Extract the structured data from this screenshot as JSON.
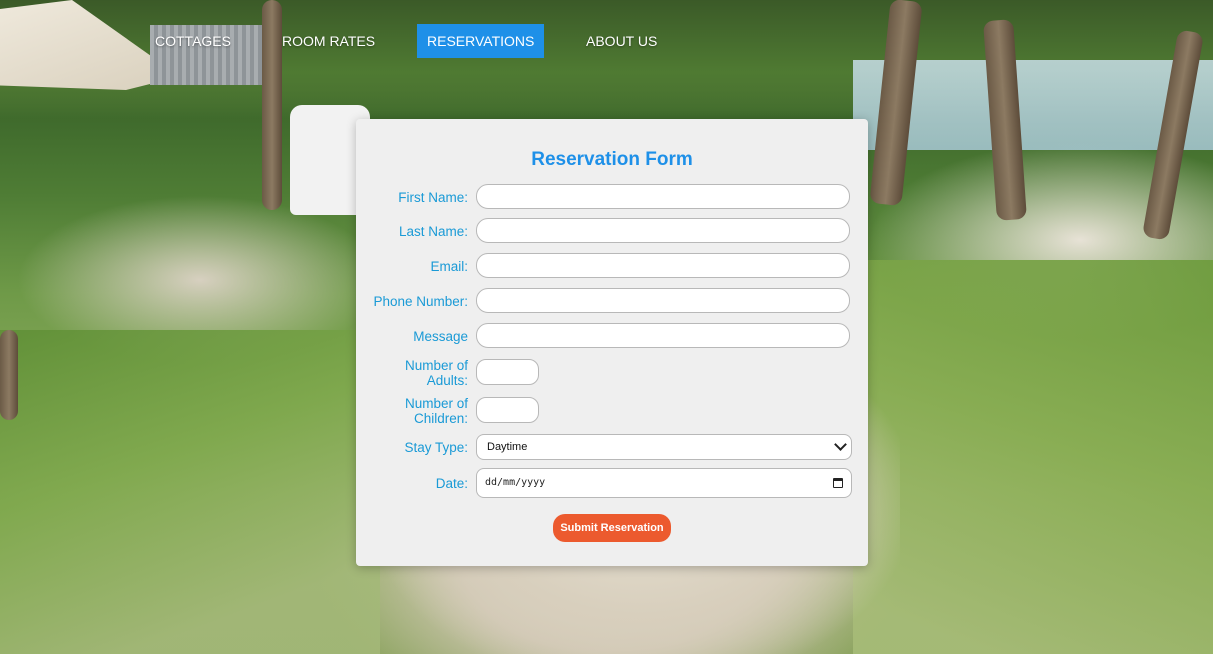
{
  "nav": {
    "items": [
      {
        "label": "COTTAGES"
      },
      {
        "label": "ROOM RATES"
      },
      {
        "label": "RESERVATIONS",
        "active": true
      },
      {
        "label": "ABOUT US"
      }
    ]
  },
  "form": {
    "title": "Reservation Form",
    "fields": {
      "first_name": {
        "label": "First Name:",
        "value": ""
      },
      "last_name": {
        "label": "Last Name:",
        "value": ""
      },
      "email": {
        "label": "Email:",
        "value": ""
      },
      "phone": {
        "label": "Phone Number:",
        "value": ""
      },
      "message": {
        "label": "Message",
        "value": ""
      },
      "adults": {
        "label": "Number of Adults:",
        "value": ""
      },
      "children": {
        "label": "Number of Children:",
        "value": ""
      },
      "stay_type": {
        "label": "Stay Type:",
        "selected": "Daytime"
      },
      "date": {
        "label": "Date:",
        "placeholder": "dd/mm/yyyy"
      }
    },
    "submit_label": "Submit Reservation"
  },
  "colors": {
    "accent": "#1e90e8",
    "label": "#1a9ad6",
    "submit": "#ec5a2e",
    "card": "#efefef"
  }
}
